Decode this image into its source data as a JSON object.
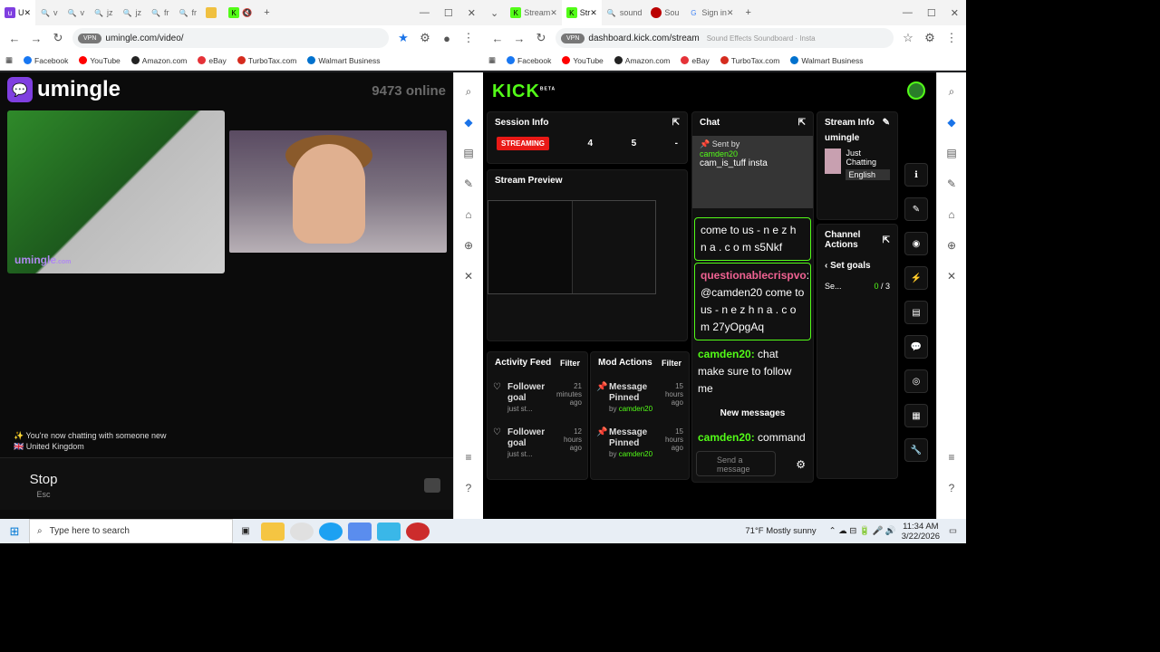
{
  "left_window": {
    "tabs": [
      "U",
      "v",
      "v",
      "jz",
      "jz",
      "fr",
      "fr",
      "yt",
      "K"
    ],
    "url": "umingle.com/video/",
    "vpn": "VPN",
    "bookmarks": [
      "Facebook",
      "YouTube",
      "Amazon.com",
      "eBay",
      "TurboTax.com",
      "Walmart Business"
    ],
    "brand": "umingle",
    "online_count": "9473",
    "online_label": "online",
    "watermark": "umingle",
    "watermark_sub": ".com",
    "status_line": "✨ You're now chatting with someone new",
    "country": "United Kingdom",
    "stop_label": "Stop",
    "stop_key": "Esc"
  },
  "right_window": {
    "tabs": [
      "Stream",
      "Str",
      "sound",
      "Sou",
      "Sign in"
    ],
    "url": "dashboard.kick.com/stream",
    "overlay_url": "Sound Effects Soundboard · Insta",
    "bookmarks": [
      "Facebook",
      "YouTube",
      "Amazon.com",
      "eBay",
      "TurboTax.com",
      "Walmart Business"
    ],
    "brand": "KICK",
    "brand_sup": "BETA",
    "session_info": {
      "title": "Session Info",
      "status": "STREAMING",
      "v1": "4",
      "v2": "5",
      "v3": "-"
    },
    "stream_preview": "Stream Preview",
    "activity": {
      "title": "Activity Feed",
      "filter": "Filter",
      "items": [
        {
          "label": "Follower goal",
          "sub": "just st...",
          "time": "21 minutes ago"
        },
        {
          "label": "Follower goal",
          "sub": "just st...",
          "time": "12 hours ago"
        }
      ]
    },
    "mod": {
      "title": "Mod Actions",
      "filter": "Filter",
      "items": [
        {
          "label": "Message Pinned",
          "by": "by",
          "user": "camden20",
          "time": "15 hours ago"
        },
        {
          "label": "Message Pinned",
          "by": "by",
          "user": "camden20",
          "time": "15 hours ago"
        }
      ]
    },
    "chat": {
      "title": "Chat",
      "pinned_by": "Sent by",
      "pinned_user": "camden20",
      "pinned_text": "cam_is_tuff insta",
      "msg0": "come to us - n e z h n a . c o m s5Nkf",
      "msg1_user": "questionablecrispvo",
      "msg1_text": ": @camden20 come to us - n e z h n a . c o m 27yOpgAq",
      "msg2_user": "camden20:",
      "msg2_text": "chat make sure to follow me",
      "new_messages": "New messages",
      "msg3_user": "camden20:",
      "msg3_text": "command",
      "input_placeholder": "Send a message"
    },
    "stream_info": {
      "title": "Stream Info",
      "channel": "umingle",
      "category": "Just Chatting",
      "language": "English"
    },
    "channel_actions": {
      "title": "Channel Actions",
      "goals": "Set goals",
      "goal_label": "Se...",
      "goal_value": "0",
      "goal_total": "/ 3"
    }
  },
  "taskbar": {
    "search_placeholder": "Type here to search",
    "weather": "71°F  Mostly sunny",
    "time": "11:34 AM",
    "date": "3/22/2026"
  }
}
